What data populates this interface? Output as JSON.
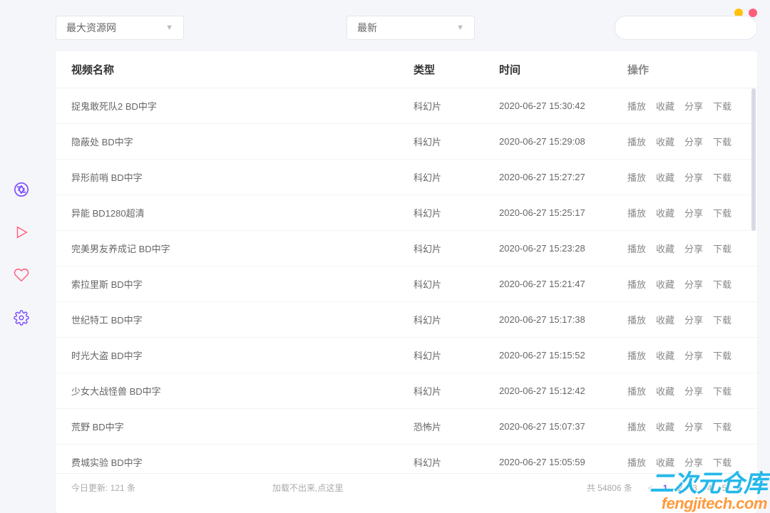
{
  "window": {
    "controls": [
      "minimize",
      "close"
    ]
  },
  "sidebar": {
    "items": [
      {
        "icon": "aperture-icon",
        "active": true
      },
      {
        "icon": "play-icon"
      },
      {
        "icon": "heart-icon"
      },
      {
        "icon": "gear-icon"
      }
    ]
  },
  "toolbar": {
    "source_select": "最大资源网",
    "sort_select": "最新",
    "search_placeholder": ""
  },
  "table": {
    "headers": {
      "name": "视频名称",
      "type": "类型",
      "time": "时间",
      "ops": "操作"
    },
    "action_labels": {
      "play": "播放",
      "fav": "收藏",
      "share": "分享",
      "download": "下载"
    },
    "rows": [
      {
        "name": "捉鬼敢死队2 BD中字",
        "type": "科幻片",
        "time": "2020-06-27 15:30:42"
      },
      {
        "name": "隐蔽处 BD中字",
        "type": "科幻片",
        "time": "2020-06-27 15:29:08"
      },
      {
        "name": "异形前哨 BD中字",
        "type": "科幻片",
        "time": "2020-06-27 15:27:27"
      },
      {
        "name": "异能 BD1280超清",
        "type": "科幻片",
        "time": "2020-06-27 15:25:17"
      },
      {
        "name": "完美男友养成记 BD中字",
        "type": "科幻片",
        "time": "2020-06-27 15:23:28"
      },
      {
        "name": "索拉里斯 BD中字",
        "type": "科幻片",
        "time": "2020-06-27 15:21:47"
      },
      {
        "name": "世纪特工 BD中字",
        "type": "科幻片",
        "time": "2020-06-27 15:17:38"
      },
      {
        "name": "时光大盗 BD中字",
        "type": "科幻片",
        "time": "2020-06-27 15:15:52"
      },
      {
        "name": "少女大战怪兽 BD中字",
        "type": "科幻片",
        "time": "2020-06-27 15:12:42"
      },
      {
        "name": "荒野 BD中字",
        "type": "恐怖片",
        "time": "2020-06-27 15:07:37"
      },
      {
        "name": "费城实验 BD中字",
        "type": "科幻片",
        "time": "2020-06-27 15:05:59"
      }
    ]
  },
  "footer": {
    "today_update": "今日更新: 121 条",
    "reload_hint": "加载不出来,点这里",
    "total": "共 54806 条",
    "pages": [
      "1",
      "2",
      "3",
      "4",
      "5",
      "6"
    ],
    "active_page": 0
  },
  "watermark": {
    "line1": "二次元仓库",
    "line2": "fengjitech.com"
  },
  "colors": {
    "accent": "#7b4dff",
    "pink": "#ff5e7d"
  }
}
